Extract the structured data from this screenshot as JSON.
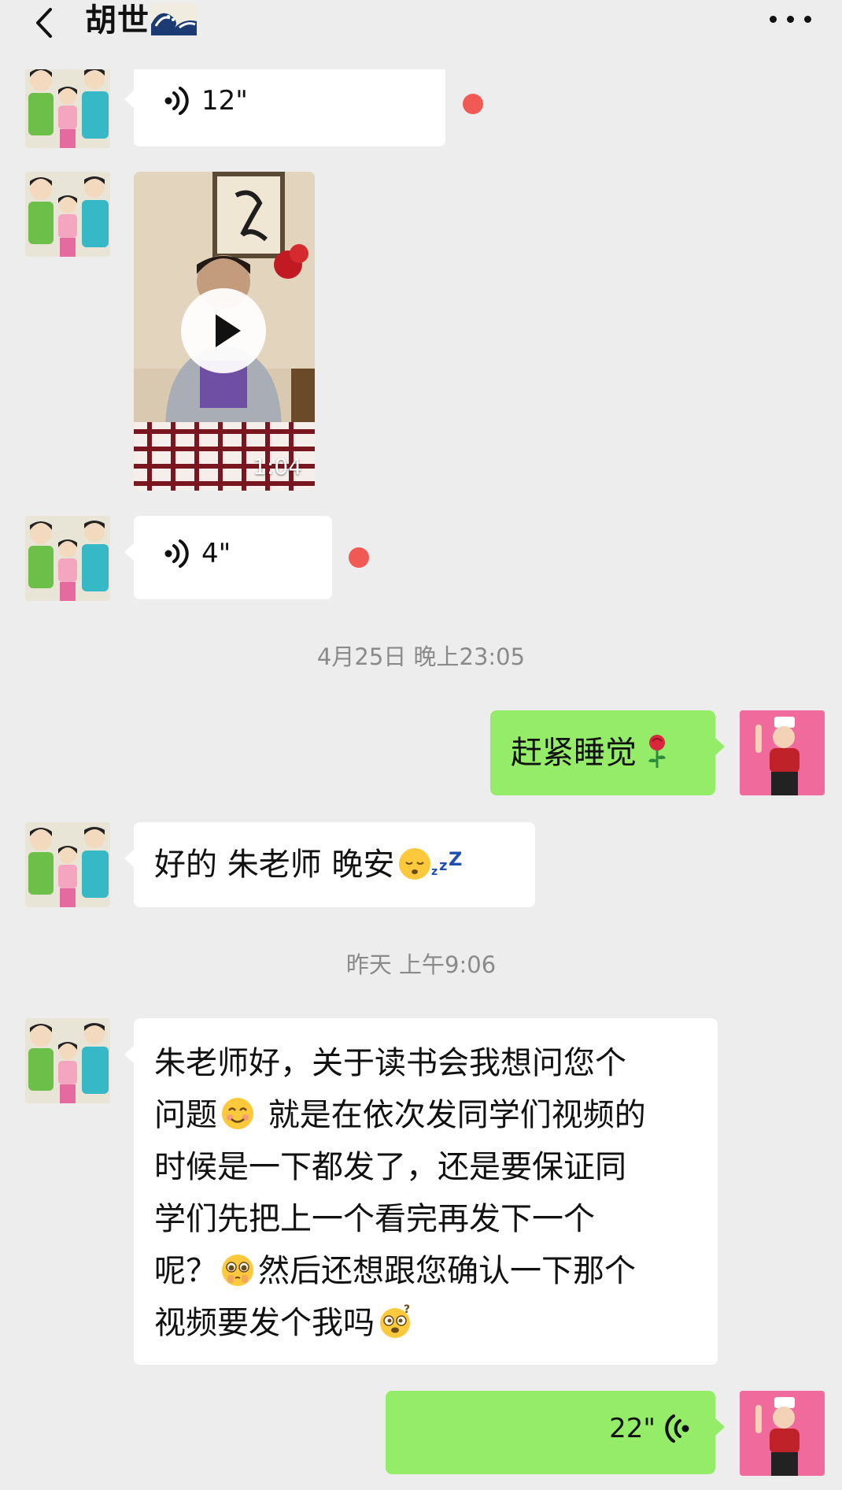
{
  "header": {
    "title": "胡世",
    "title_emoji": "wave-emoji",
    "back_icon": "chevron-left-icon",
    "more_icon": "ellipsis-icon"
  },
  "messages": [
    {
      "type": "voice",
      "from": "them",
      "duration": "12\"",
      "unread": true
    },
    {
      "type": "video",
      "from": "them",
      "duration": "1:04"
    },
    {
      "type": "voice",
      "from": "them",
      "duration": "4\"",
      "unread": true
    },
    {
      "type": "timestamp",
      "text": "4月25日 晚上23:05"
    },
    {
      "type": "text",
      "from": "me",
      "text": "赶紧睡觉",
      "emoji": "rose-emoji"
    },
    {
      "type": "text",
      "from": "them",
      "text": "好的 朱老师 晚安",
      "emoji": "sleeping-emoji"
    },
    {
      "type": "timestamp",
      "text": "昨天 上午9:06"
    },
    {
      "type": "text",
      "from": "them",
      "lines": [
        "朱老师好，关于读书会我想问您个",
        "问题",
        " 就是在依次发同学们视频的",
        "时候是一下都发了，还是要保证同",
        "学们先把上一个看完再发下一个",
        "呢？",
        "然后还想跟您确认一下那个",
        "视频要发个我吗"
      ],
      "emojis": [
        "smile-emoji",
        "pleading-emoji",
        "dizzy-emoji"
      ]
    },
    {
      "type": "voice",
      "from": "me",
      "duration": "22\""
    }
  ],
  "colors": {
    "background": "#ededed",
    "bubble_them": "#ffffff",
    "bubble_me": "#95ec69",
    "unread_dot": "#f15a54",
    "timestamp": "#8a8a8a"
  }
}
